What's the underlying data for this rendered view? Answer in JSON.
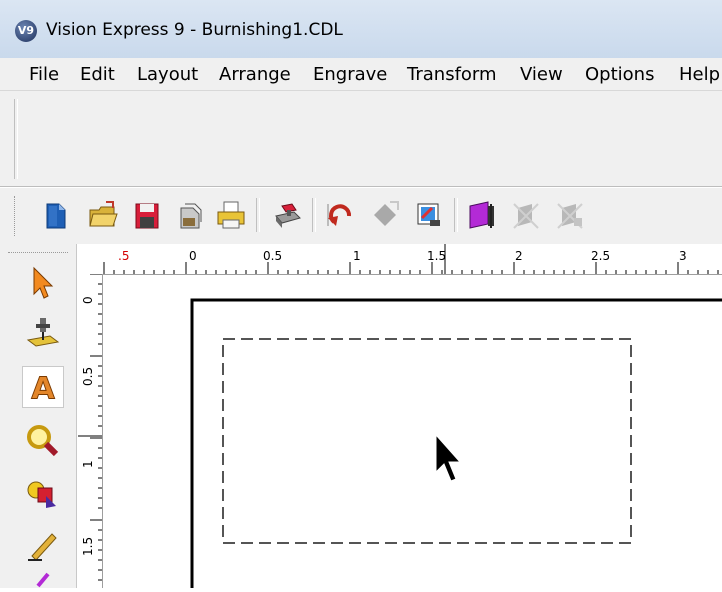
{
  "window": {
    "title": "Vision Express 9 - Burnishing1.CDL",
    "app_icon_text": "V9"
  },
  "menu": {
    "items": [
      "File",
      "Edit",
      "Layout",
      "Arrange",
      "Engrave",
      "Transform",
      "View",
      "Options",
      "Help"
    ]
  },
  "toolbar": {
    "buttons": [
      "new-document-icon",
      "open-folder-icon",
      "save-icon",
      "save-all-icon",
      "print-icon",
      "machine-setup-icon",
      "undo-icon",
      "redo-icon",
      "zoom-selection-icon",
      "group-icon",
      "ungroup-icon",
      "ungroup-all-icon"
    ]
  },
  "left_toolbox": {
    "tools": [
      "select-arrow-icon",
      "engrave-tool-icon",
      "text-tool-icon",
      "zoom-tool-icon",
      "shapes-tool-icon",
      "pen-tool-icon",
      "brush-tool-icon"
    ],
    "active_tool": "text-tool-icon",
    "text_tool_glyph": "A"
  },
  "rulers": {
    "horizontal_labels": [
      ".5",
      "0",
      "0.5",
      "1",
      "1.5",
      "2",
      "2.5",
      "3"
    ],
    "vertical_labels": [
      "0",
      "0.5",
      "1",
      "1.5"
    ]
  },
  "canvas": {
    "elements": [
      "page-border",
      "dashed-selection-box",
      "mouse-cursor"
    ]
  }
}
